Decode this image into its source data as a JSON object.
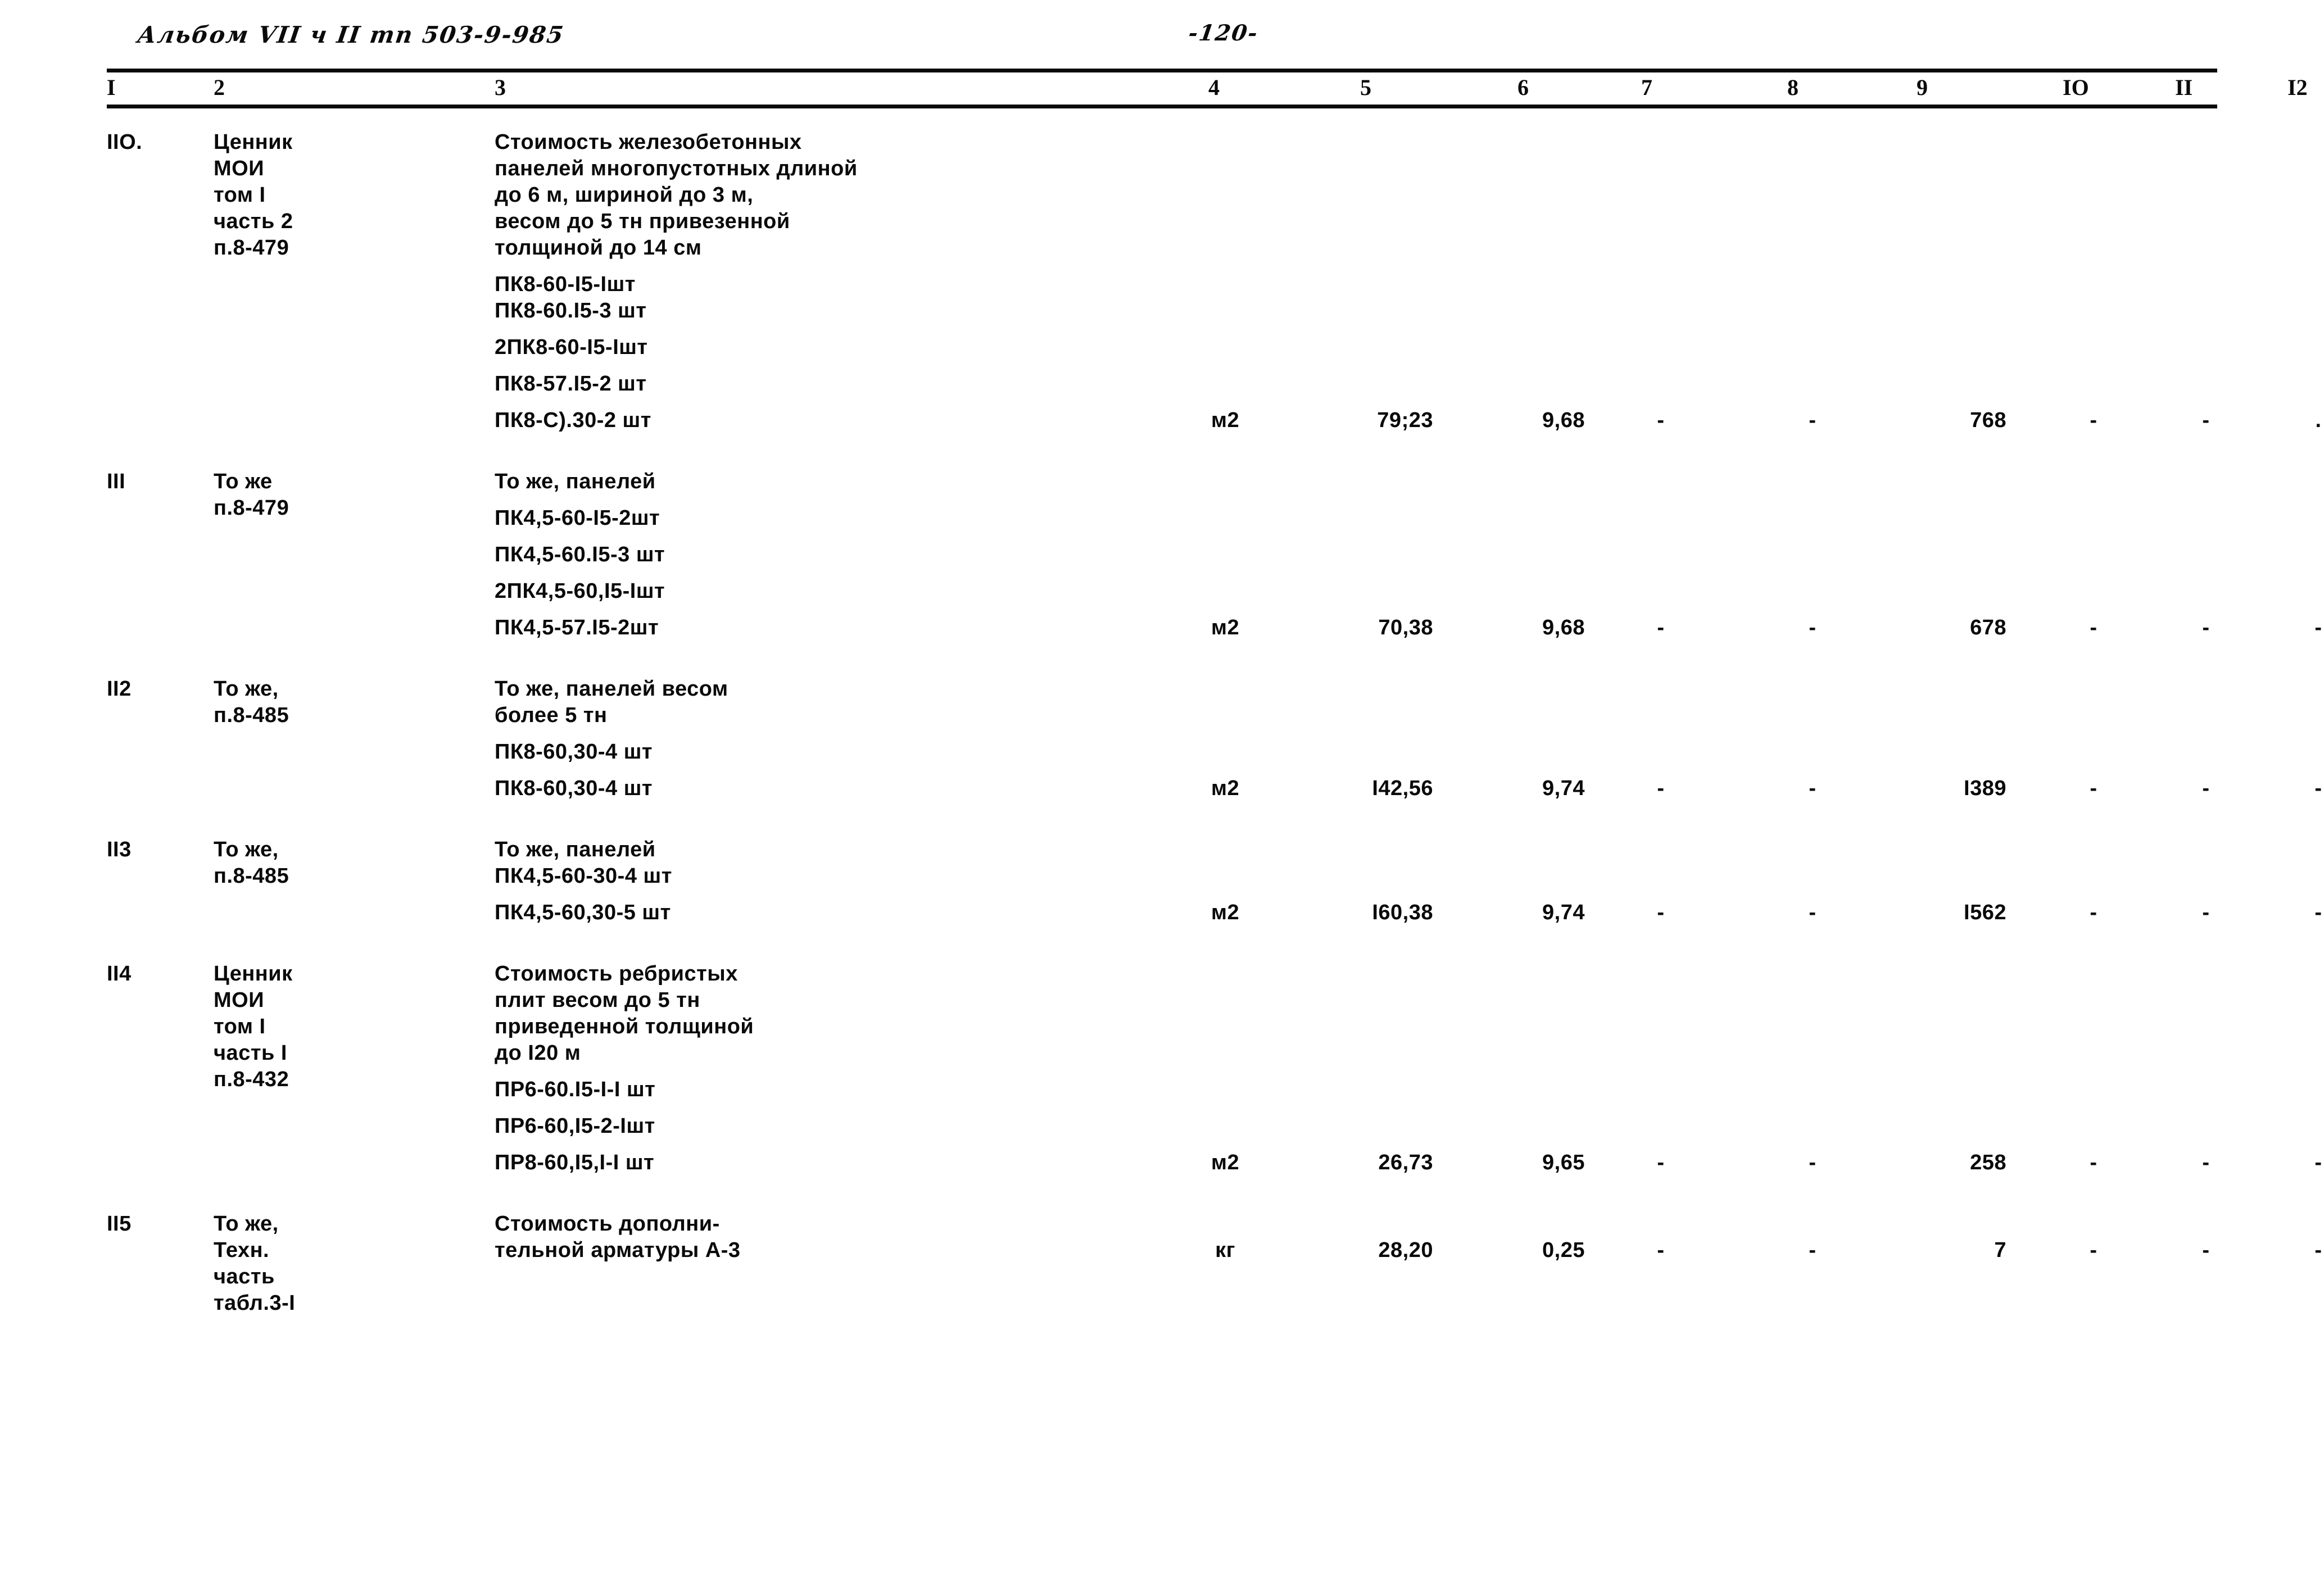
{
  "header": {
    "album_note": "Альбом VII ч II тп 503-9-985",
    "page_number": "-120-"
  },
  "table": {
    "column_numbers": [
      "I",
      "2",
      "3",
      "4",
      "5",
      "6",
      "7",
      "8",
      "9",
      "IO",
      "II",
      "I2"
    ],
    "rows": [
      {
        "num": "IIO.",
        "ref": "Ценник\nМОИ\nтом I\nчасть 2\nп.8-479",
        "desc_main": "Стоимость железобетонных\nпанелей многопустотных длиной\nдо 6 м, шириной до 3 м,\nвесом до 5 тн привезенной\nтолщиной до 14 см",
        "desc_items": [
          "ПК8-60-I5-Iшт\nПК8-60.I5-3 шт",
          "2ПК8-60-I5-Iшт",
          "ПК8-57.I5-2 шт",
          "ПК8-С).30-2 шт"
        ],
        "unit": "м2",
        "v5": "79;23",
        "v6": "9,68",
        "v7": "-",
        "v8": "-",
        "v9": "768",
        "v10": "-",
        "v11": "-",
        "v12": "."
      },
      {
        "num": "III",
        "ref": "То же\nп.8-479",
        "desc_main": "То же, панелей",
        "desc_items": [
          "ПК4,5-60-I5-2шт",
          "ПК4,5-60.I5-3 шт",
          "2ПК4,5-60,I5-Iшт",
          "ПК4,5-57.I5-2шт"
        ],
        "unit": "м2",
        "v5": "70,38",
        "v6": "9,68",
        "v7": "-",
        "v8": "-",
        "v9": "678",
        "v10": "-",
        "v11": "-",
        "v12": "-"
      },
      {
        "num": "II2",
        "ref": "То же,\nп.8-485",
        "desc_main": "То же, панелей весом\nболее 5 тн",
        "desc_items": [
          "ПК8-60,30-4 шт",
          "ПК8-60,30-4 шт"
        ],
        "unit": "м2",
        "v5": "I42,56",
        "v6": "9,74",
        "v7": "-",
        "v8": "-",
        "v9": "I389",
        "v10": "-",
        "v11": "-",
        "v12": "-"
      },
      {
        "num": "II3",
        "ref": "То же,\nп.8-485",
        "desc_main": "То же, панелей\nПК4,5-60-30-4 шт",
        "desc_items": [
          "ПК4,5-60,30-5 шт"
        ],
        "unit": "м2",
        "v5": "I60,38",
        "v6": "9,74",
        "v7": "-",
        "v8": "-",
        "v9": "I562",
        "v10": "-",
        "v11": "-",
        "v12": "-"
      },
      {
        "num": "II4",
        "ref": "Ценник\nМОИ\nтом I\nчасть I\nп.8-432",
        "desc_main": "Стоимость ребристых\nплит весом до 5 тн\nприведенной толщиной\nдо I20 м",
        "desc_items": [
          "ПР6-60.I5-I-I шт",
          "ПР6-60,I5-2-Iшт",
          "ПР8-60,I5,I-I шт"
        ],
        "unit": "м2",
        "v5": "26,73",
        "v6": "9,65",
        "v7": "-",
        "v8": "-",
        "v9": "258",
        "v10": "-",
        "v11": "-",
        "v12": "-"
      },
      {
        "num": "II5",
        "ref": "То же,\nТехн.\nчасть\nтабл.3-I",
        "desc_main": "Стоимость дополни-\nтельной арматуры А-3",
        "desc_items": [],
        "unit": "кг",
        "v5": "28,20",
        "v6": "0,25",
        "v7": "-",
        "v8": "-",
        "v9": "7",
        "v10": "-",
        "v11": "-",
        "v12": "-"
      }
    ]
  }
}
